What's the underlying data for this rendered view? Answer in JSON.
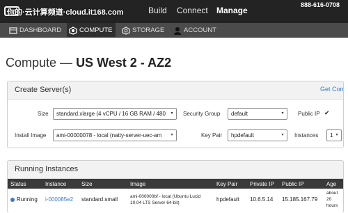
{
  "watermark": "你的·云计算频道·cloud.it168.com",
  "phone": "888-616-0708",
  "topnav": {
    "build": "Build",
    "connect": "Connect",
    "manage": "Manage"
  },
  "subnav": [
    {
      "label": "DASHBOARD",
      "icon": "dashboard-icon"
    },
    {
      "label": "COMPUTE",
      "icon": "compute-icon"
    },
    {
      "label": "STORAGE",
      "icon": "storage-icon"
    },
    {
      "label": "ACCOUNT",
      "icon": "account-icon"
    }
  ],
  "page_title_prefix": "Compute —",
  "page_title_region": "US West 2 - AZ2",
  "create": {
    "title": "Create Server(s)",
    "get_link": "Get Comp",
    "size_label": "Size",
    "size_value": "standard.xlarge (4 vCPU / 16 GB RAM / 480",
    "security_label": "Security Group",
    "security_value": "default",
    "public_ip_label": "Public IP",
    "public_ip_checked": true,
    "image_label": "Install Image",
    "image_value": "ami-00000078 - local (natty-server-uec-am",
    "keypair_label": "Key Pair",
    "keypair_value": "hpdefault",
    "instances_label": "Instances",
    "instances_value": "1"
  },
  "running": {
    "title": "Running Instances",
    "columns": [
      "Status",
      "Instance",
      "Size",
      "Image",
      "Key Pair",
      "Private IP",
      "Public IP",
      "Age"
    ],
    "rows": [
      {
        "status": "Running",
        "instance": "i-000085e2",
        "size": "standard.small",
        "image": "ami-000000bf - local (Ubuntu Lucid 10.04 LTS Server 64-bit)",
        "key_pair": "hpdefault",
        "private_ip": "10.6.5.14",
        "public_ip": "15.185.167.79",
        "age": "about 20 hours"
      }
    ]
  },
  "colors": {
    "accent": "#3a7bc8",
    "topbar": "#232323",
    "subbar": "#4b4b4b"
  }
}
